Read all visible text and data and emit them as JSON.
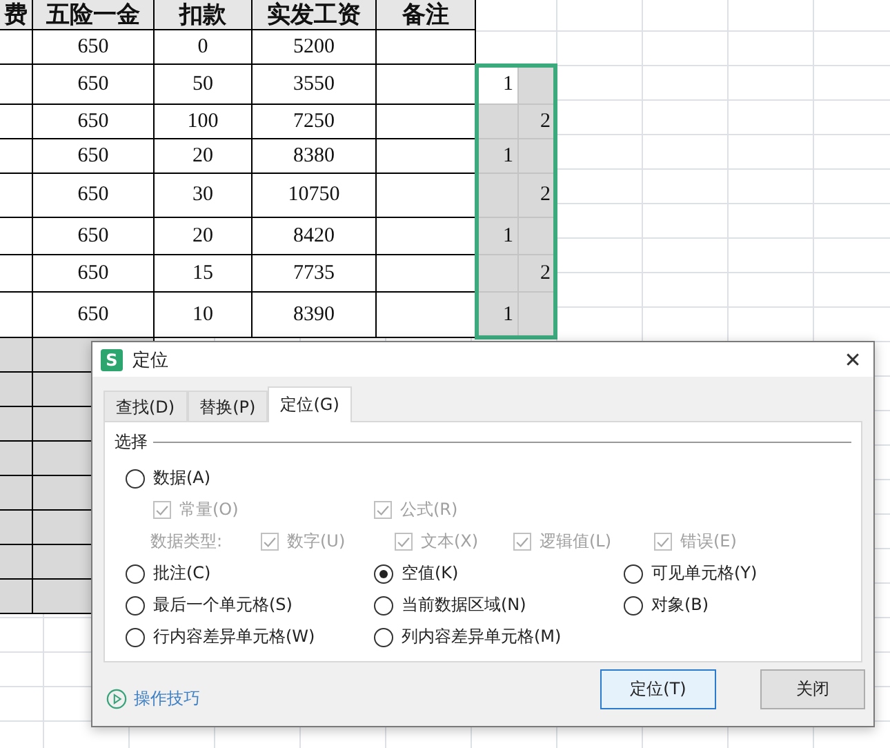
{
  "sheet": {
    "columns": [
      "费",
      "五险一金",
      "扣款",
      "实发工资",
      "备注"
    ],
    "rows": [
      {
        "cells": [
          "",
          "650",
          "0",
          "5200",
          ""
        ]
      },
      {
        "cells": [
          "",
          "650",
          "50",
          "3550",
          ""
        ],
        "helper_1": "1"
      },
      {
        "cells": [
          "",
          "650",
          "100",
          "7250",
          ""
        ],
        "helper_2": "2"
      },
      {
        "cells": [
          "",
          "650",
          "20",
          "8380",
          ""
        ],
        "helper_1": "1"
      },
      {
        "cells": [
          "",
          "650",
          "30",
          "10750",
          ""
        ],
        "helper_2": "2"
      },
      {
        "cells": [
          "",
          "650",
          "20",
          "8420",
          ""
        ],
        "helper_1": "1"
      },
      {
        "cells": [
          "",
          "650",
          "15",
          "7735",
          ""
        ],
        "helper_2": "2"
      },
      {
        "cells": [
          "",
          "650",
          "10",
          "8390",
          ""
        ],
        "helper_1": "1"
      }
    ]
  },
  "dialog": {
    "app_icon": "S",
    "title": "定位",
    "close": "✕",
    "tabs": [
      {
        "label": "查找(D)",
        "selected": false
      },
      {
        "label": "替换(P)",
        "selected": false
      },
      {
        "label": "定位(G)",
        "selected": true
      }
    ],
    "group_label": "选择",
    "option_rows": [
      {
        "kind": "main",
        "items": [
          {
            "kind": "radio",
            "label": "数据(A)",
            "selected": false
          }
        ]
      },
      {
        "kind": "sub",
        "items": [
          {
            "kind": "checkbox",
            "label": "常量(O)",
            "checked": true,
            "disabled": true
          },
          {
            "kind": "checkbox",
            "label": "公式(R)",
            "checked": true,
            "disabled": true
          }
        ]
      },
      {
        "kind": "types",
        "items": [
          {
            "kind": "label",
            "label": "数据类型:",
            "disabled": true
          },
          {
            "kind": "checkbox",
            "label": "数字(U)",
            "checked": true,
            "disabled": true
          },
          {
            "kind": "checkbox",
            "label": "文本(X)",
            "checked": true,
            "disabled": true
          },
          {
            "kind": "checkbox",
            "label": "逻辑值(L)",
            "checked": true,
            "disabled": true
          },
          {
            "kind": "checkbox",
            "label": "错误(E)",
            "checked": true,
            "disabled": true
          }
        ]
      },
      {
        "kind": "main",
        "items": [
          {
            "kind": "radio",
            "label": "批注(C)",
            "selected": false
          },
          {
            "kind": "radio",
            "label": "空值(K)",
            "selected": true
          },
          {
            "kind": "radio",
            "label": "可见单元格(Y)",
            "selected": false
          }
        ]
      },
      {
        "kind": "main",
        "items": [
          {
            "kind": "radio",
            "label": "最后一个单元格(S)",
            "selected": false
          },
          {
            "kind": "radio",
            "label": "当前数据区域(N)",
            "selected": false
          },
          {
            "kind": "radio",
            "label": "对象(B)",
            "selected": false
          }
        ]
      },
      {
        "kind": "main",
        "items": [
          {
            "kind": "radio",
            "label": "行内容差异单元格(W)",
            "selected": false
          },
          {
            "kind": "radio",
            "label": "列内容差异单元格(M)",
            "selected": false
          }
        ]
      }
    ],
    "tips_link": "操作技巧",
    "buttons": [
      {
        "label": "定位(T)",
        "kind": "primary"
      },
      {
        "label": "关闭",
        "kind": "normal"
      }
    ]
  }
}
